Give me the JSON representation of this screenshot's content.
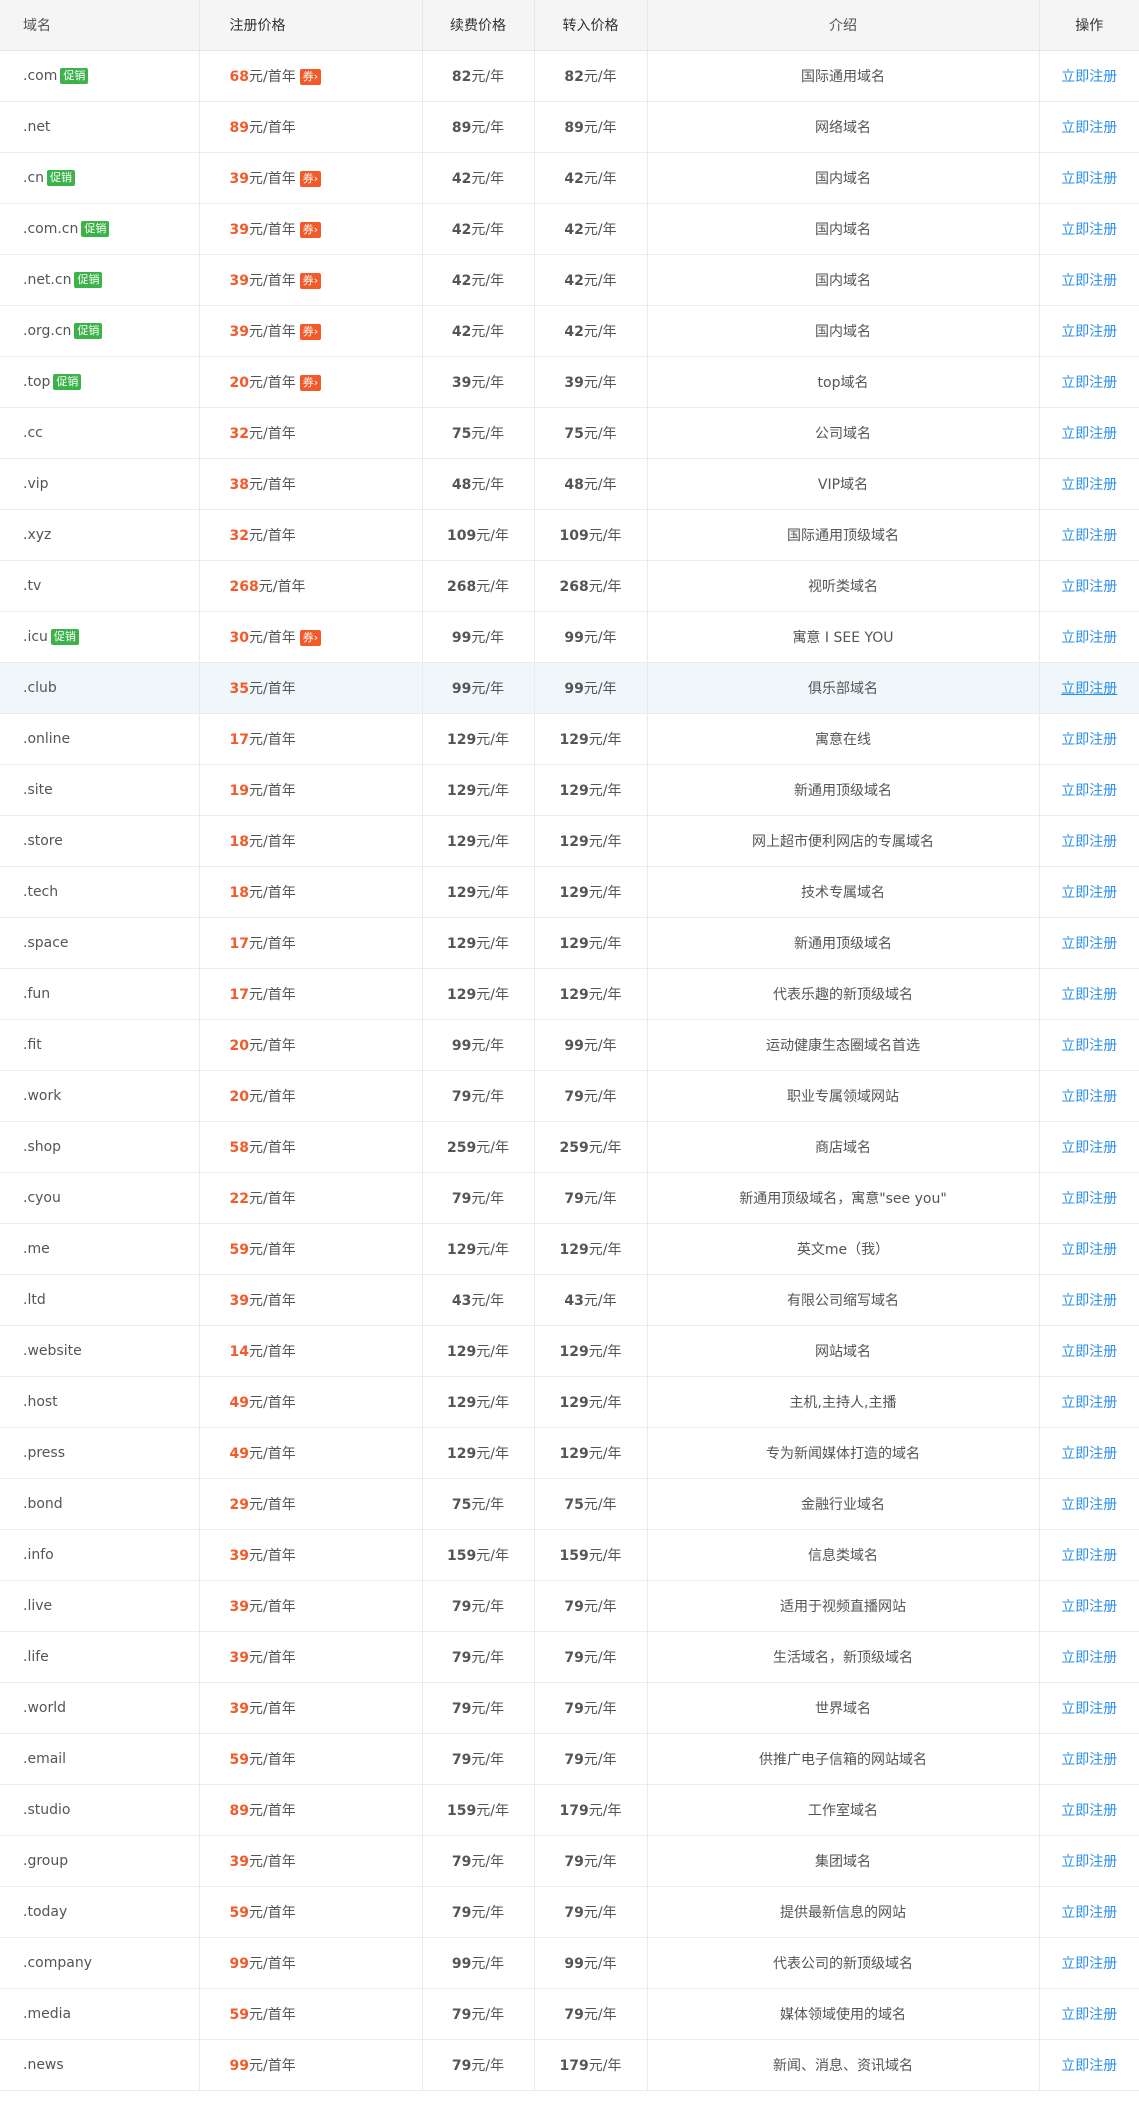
{
  "header": {
    "domain": "域名",
    "register": "注册价格",
    "renew": "续费价格",
    "transfer": "转入价格",
    "intro": "介绍",
    "action": "操作"
  },
  "labels": {
    "promo": "促销",
    "coupon": "券›",
    "reg_unit": "元/首年",
    "year_unit": "元/年",
    "action_link": "立即注册"
  },
  "colors": {
    "price": "#f25b29",
    "promo": "#3cb34a",
    "coupon": "#f25b29",
    "link": "#2a8fe8",
    "highlight_row": "#f0f7fb"
  },
  "highlighted_row": 12,
  "rows": [
    {
      "domain": ".com",
      "promo": true,
      "reg": "68",
      "coupon": true,
      "renew": "82",
      "transfer": "82",
      "intro": "国际通用域名"
    },
    {
      "domain": ".net",
      "promo": false,
      "reg": "89",
      "coupon": false,
      "renew": "89",
      "transfer": "89",
      "intro": "网络域名"
    },
    {
      "domain": ".cn",
      "promo": true,
      "reg": "39",
      "coupon": true,
      "renew": "42",
      "transfer": "42",
      "intro": "国内域名"
    },
    {
      "domain": ".com.cn",
      "promo": true,
      "reg": "39",
      "coupon": true,
      "renew": "42",
      "transfer": "42",
      "intro": "国内域名"
    },
    {
      "domain": ".net.cn",
      "promo": true,
      "reg": "39",
      "coupon": true,
      "renew": "42",
      "transfer": "42",
      "intro": "国内域名"
    },
    {
      "domain": ".org.cn",
      "promo": true,
      "reg": "39",
      "coupon": true,
      "renew": "42",
      "transfer": "42",
      "intro": "国内域名"
    },
    {
      "domain": ".top",
      "promo": true,
      "reg": "20",
      "coupon": true,
      "renew": "39",
      "transfer": "39",
      "intro": "top域名"
    },
    {
      "domain": ".cc",
      "promo": false,
      "reg": "32",
      "coupon": false,
      "renew": "75",
      "transfer": "75",
      "intro": "公司域名"
    },
    {
      "domain": ".vip",
      "promo": false,
      "reg": "38",
      "coupon": false,
      "renew": "48",
      "transfer": "48",
      "intro": "VIP域名"
    },
    {
      "domain": ".xyz",
      "promo": false,
      "reg": "32",
      "coupon": false,
      "renew": "109",
      "transfer": "109",
      "intro": "国际通用顶级域名"
    },
    {
      "domain": ".tv",
      "promo": false,
      "reg": "268",
      "coupon": false,
      "renew": "268",
      "transfer": "268",
      "intro": "视听类域名"
    },
    {
      "domain": ".icu",
      "promo": true,
      "reg": "30",
      "coupon": true,
      "renew": "99",
      "transfer": "99",
      "intro": "寓意 I SEE YOU"
    },
    {
      "domain": ".club",
      "promo": false,
      "reg": "35",
      "coupon": false,
      "renew": "99",
      "transfer": "99",
      "intro": "俱乐部域名"
    },
    {
      "domain": ".online",
      "promo": false,
      "reg": "17",
      "coupon": false,
      "renew": "129",
      "transfer": "129",
      "intro": "寓意在线"
    },
    {
      "domain": ".site",
      "promo": false,
      "reg": "19",
      "coupon": false,
      "renew": "129",
      "transfer": "129",
      "intro": "新通用顶级域名"
    },
    {
      "domain": ".store",
      "promo": false,
      "reg": "18",
      "coupon": false,
      "renew": "129",
      "transfer": "129",
      "intro": "网上超市便利网店的专属域名"
    },
    {
      "domain": ".tech",
      "promo": false,
      "reg": "18",
      "coupon": false,
      "renew": "129",
      "transfer": "129",
      "intro": "技术专属域名"
    },
    {
      "domain": ".space",
      "promo": false,
      "reg": "17",
      "coupon": false,
      "renew": "129",
      "transfer": "129",
      "intro": "新通用顶级域名"
    },
    {
      "domain": ".fun",
      "promo": false,
      "reg": "17",
      "coupon": false,
      "renew": "129",
      "transfer": "129",
      "intro": "代表乐趣的新顶级域名"
    },
    {
      "domain": ".fit",
      "promo": false,
      "reg": "20",
      "coupon": false,
      "renew": "99",
      "transfer": "99",
      "intro": "运动健康生态圈域名首选"
    },
    {
      "domain": ".work",
      "promo": false,
      "reg": "20",
      "coupon": false,
      "renew": "79",
      "transfer": "79",
      "intro": "职业专属领域网站"
    },
    {
      "domain": ".shop",
      "promo": false,
      "reg": "58",
      "coupon": false,
      "renew": "259",
      "transfer": "259",
      "intro": "商店域名"
    },
    {
      "domain": ".cyou",
      "promo": false,
      "reg": "22",
      "coupon": false,
      "renew": "79",
      "transfer": "79",
      "intro": "新通用顶级域名，寓意\"see you\""
    },
    {
      "domain": ".me",
      "promo": false,
      "reg": "59",
      "coupon": false,
      "renew": "129",
      "transfer": "129",
      "intro": "英文me（我）"
    },
    {
      "domain": ".ltd",
      "promo": false,
      "reg": "39",
      "coupon": false,
      "renew": "43",
      "transfer": "43",
      "intro": "有限公司缩写域名"
    },
    {
      "domain": ".website",
      "promo": false,
      "reg": "14",
      "coupon": false,
      "renew": "129",
      "transfer": "129",
      "intro": "网站域名"
    },
    {
      "domain": ".host",
      "promo": false,
      "reg": "49",
      "coupon": false,
      "renew": "129",
      "transfer": "129",
      "intro": "主机,主持人,主播"
    },
    {
      "domain": ".press",
      "promo": false,
      "reg": "49",
      "coupon": false,
      "renew": "129",
      "transfer": "129",
      "intro": "专为新闻媒体打造的域名"
    },
    {
      "domain": ".bond",
      "promo": false,
      "reg": "29",
      "coupon": false,
      "renew": "75",
      "transfer": "75",
      "intro": "金融行业域名"
    },
    {
      "domain": ".info",
      "promo": false,
      "reg": "39",
      "coupon": false,
      "renew": "159",
      "transfer": "159",
      "intro": "信息类域名"
    },
    {
      "domain": ".live",
      "promo": false,
      "reg": "39",
      "coupon": false,
      "renew": "79",
      "transfer": "79",
      "intro": "适用于视频直播网站"
    },
    {
      "domain": ".life",
      "promo": false,
      "reg": "39",
      "coupon": false,
      "renew": "79",
      "transfer": "79",
      "intro": "生活域名，新顶级域名"
    },
    {
      "domain": ".world",
      "promo": false,
      "reg": "39",
      "coupon": false,
      "renew": "79",
      "transfer": "79",
      "intro": "世界域名"
    },
    {
      "domain": ".email",
      "promo": false,
      "reg": "59",
      "coupon": false,
      "renew": "79",
      "transfer": "79",
      "intro": "供推广电子信箱的网站域名"
    },
    {
      "domain": ".studio",
      "promo": false,
      "reg": "89",
      "coupon": false,
      "renew": "159",
      "transfer": "179",
      "intro": "工作室域名"
    },
    {
      "domain": ".group",
      "promo": false,
      "reg": "39",
      "coupon": false,
      "renew": "79",
      "transfer": "79",
      "intro": "集团域名"
    },
    {
      "domain": ".today",
      "promo": false,
      "reg": "59",
      "coupon": false,
      "renew": "79",
      "transfer": "79",
      "intro": "提供最新信息的网站"
    },
    {
      "domain": ".company",
      "promo": false,
      "reg": "99",
      "coupon": false,
      "renew": "99",
      "transfer": "99",
      "intro": "代表公司的新顶级域名"
    },
    {
      "domain": ".media",
      "promo": false,
      "reg": "59",
      "coupon": false,
      "renew": "79",
      "transfer": "79",
      "intro": "媒体领域使用的域名"
    },
    {
      "domain": ".news",
      "promo": false,
      "reg": "99",
      "coupon": false,
      "renew": "79",
      "transfer": "179",
      "intro": "新闻、消息、资讯域名"
    }
  ]
}
